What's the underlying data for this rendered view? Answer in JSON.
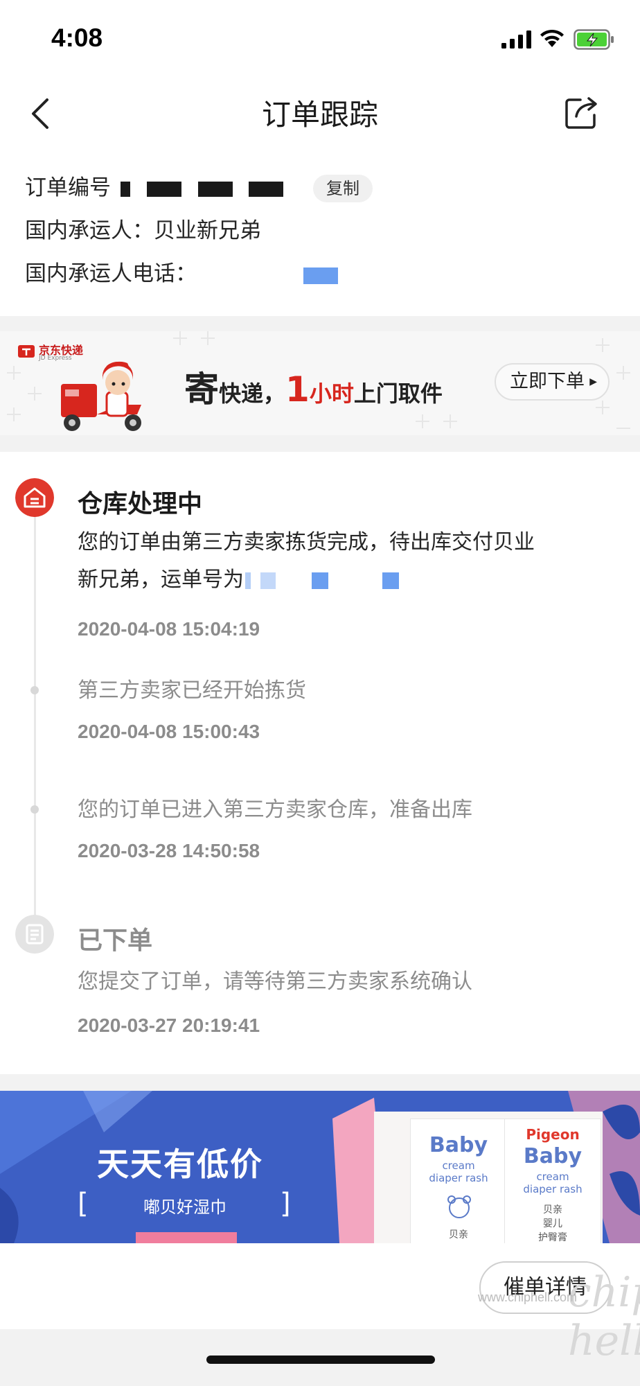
{
  "status_bar": {
    "time": "4:08"
  },
  "nav": {
    "title": "订单跟踪"
  },
  "order": {
    "number_label": "订单编号",
    "copy_label": "复制",
    "carrier": "国内承运人：贝业新兄弟",
    "carrier_phone_label": "国内承运人电话："
  },
  "jd_banner": {
    "logo_text": "京东快递",
    "logo_sub": "JD Express",
    "slogan_part1": "寄",
    "slogan_part2": "快递，",
    "slogan_part3": "1",
    "slogan_part4": "小时",
    "slogan_part5": "上门取件",
    "button_label": "立即下单"
  },
  "timeline": {
    "events": [
      {
        "heading": "仓库处理中",
        "text_line1": "您的订单由第三方卖家拣货完成，待出库交付贝业",
        "text_line2": "新兄弟，运单号为",
        "time": "2020-04-08 15:04:19"
      },
      {
        "text": "第三方卖家已经开始拣货",
        "time": "2020-04-08 15:00:43"
      },
      {
        "text": "您的订单已进入第三方卖家仓库，准备出库",
        "time": "2020-03-28 14:50:58"
      },
      {
        "heading": "已下单",
        "text": "您提交了订单，请等待第三方卖家系统确认",
        "time": "2020-03-27 20:19:41"
      }
    ]
  },
  "promo": {
    "title": "天天有低价",
    "subtitle": "嘟贝好湿巾",
    "product_brand": "Pigeon",
    "product_name": "Baby",
    "product_desc1": "cream",
    "product_desc2": "diaper rash",
    "product_cn1": "贝亲",
    "product_cn2": "婴儿",
    "product_cn3": "护臀膏"
  },
  "bottom": {
    "urge_button": "催单详情"
  },
  "watermark": {
    "site": "www.chiphell.com",
    "logo": "chip hell"
  },
  "colors": {
    "accent_red": "#e0382c",
    "link_blue": "#6a9ef0",
    "promo_blue": "#3d5fc4"
  }
}
